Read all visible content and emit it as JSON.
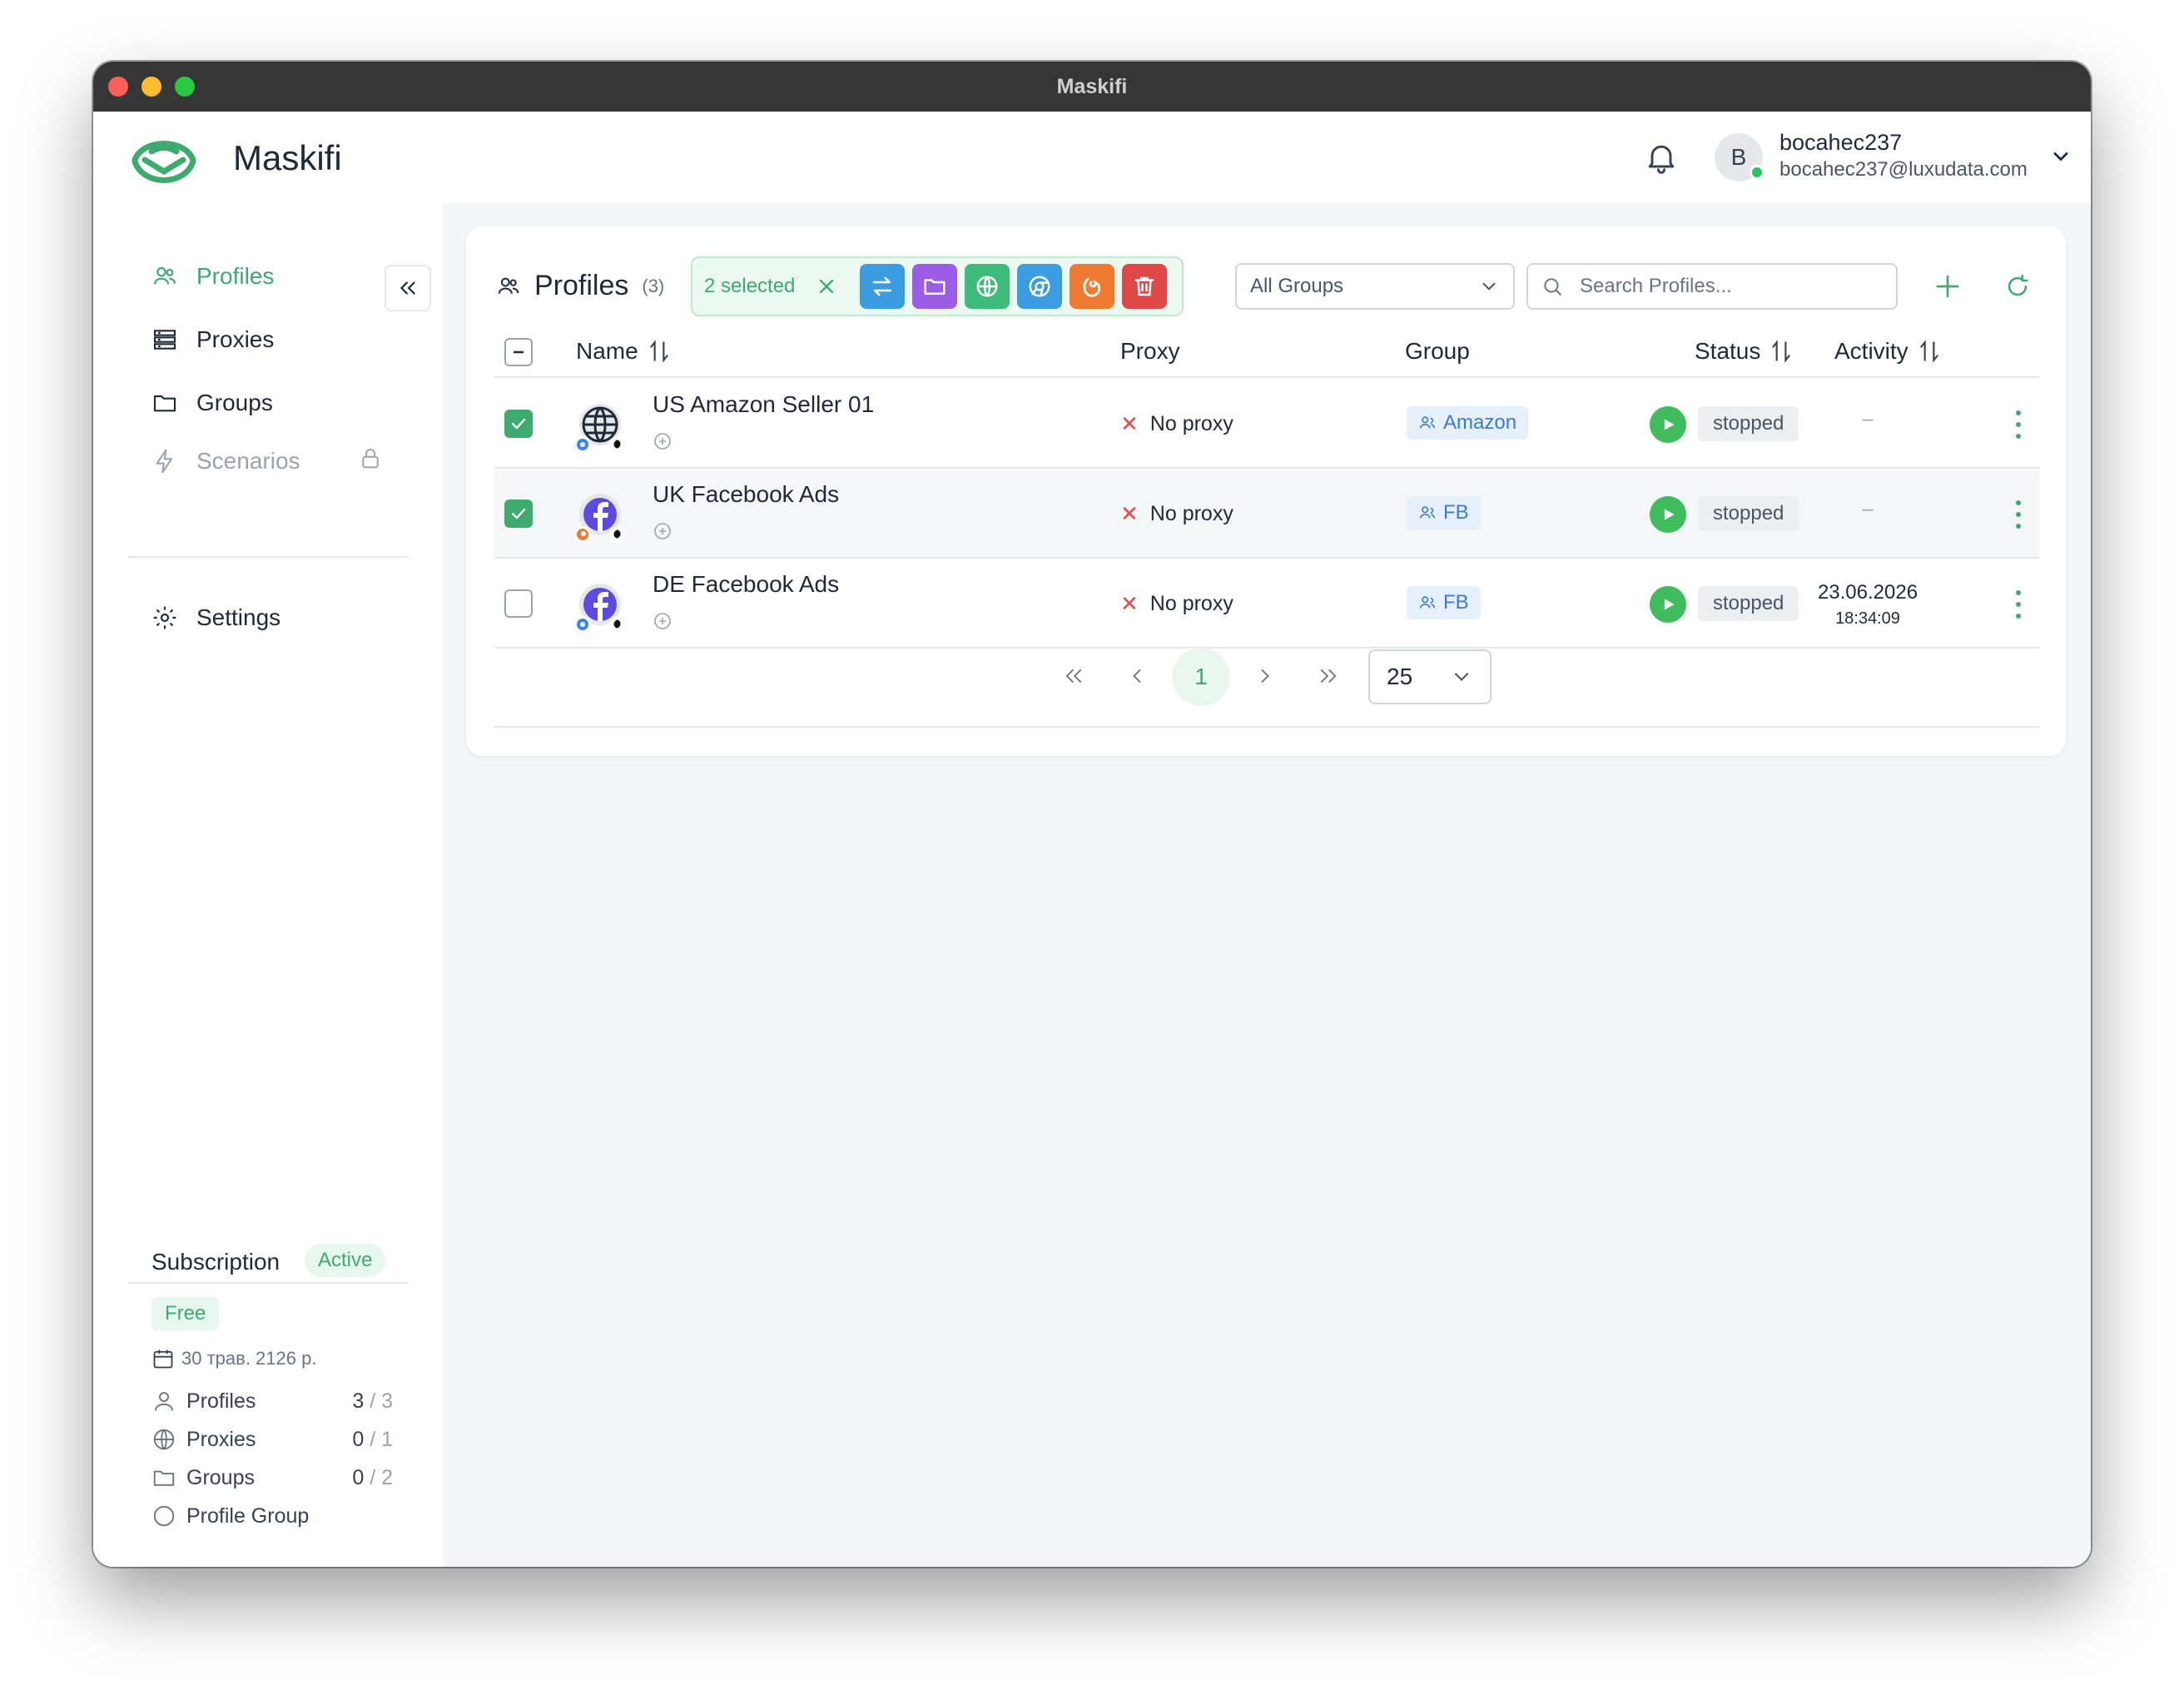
{
  "window": {
    "title": "Maskifi"
  },
  "app": {
    "brand": "Maskifi",
    "accent": "#3daa6e"
  },
  "user": {
    "initial": "B",
    "name": "bocahec237",
    "email": "bocahec237@luxudata.com"
  },
  "sidebar": {
    "items": [
      {
        "label": "Profiles",
        "icon": "users-icon",
        "active": true
      },
      {
        "label": "Proxies",
        "icon": "server-icon"
      },
      {
        "label": "Groups",
        "icon": "folder-icon"
      },
      {
        "label": "Scenarios",
        "icon": "bolt-icon",
        "locked": true
      },
      {
        "label": "Settings",
        "icon": "gear-icon"
      }
    ]
  },
  "subscription": {
    "title": "Subscription",
    "state": "Active",
    "plan": "Free",
    "date": "30 трав. 2126 р.",
    "limits": [
      {
        "label": "Profiles",
        "used": "3",
        "max": "/ 3"
      },
      {
        "label": "Proxies",
        "used": "0",
        "max": "/ 1"
      },
      {
        "label": "Groups",
        "used": "0",
        "max": "/ 2"
      },
      {
        "label": "Profile Group",
        "used": "",
        "max": ""
      }
    ]
  },
  "profiles": {
    "title": "Profiles",
    "count": "(3)",
    "selected_label": "2 selected",
    "group_filter": "All Groups",
    "search_placeholder": "Search Profiles...",
    "columns": {
      "name": "Name",
      "proxy": "Proxy",
      "group": "Group",
      "status": "Status",
      "activity": "Activity"
    },
    "rows": [
      {
        "name": "US Amazon Seller 01",
        "proxy": "No proxy",
        "group": "Amazon",
        "status": "stopped",
        "activity_date": "–",
        "activity_time": "",
        "checked": true,
        "icon": "globe-icon",
        "browser": "chrome-icon"
      },
      {
        "name": "UK Facebook Ads",
        "proxy": "No proxy",
        "group": "FB",
        "status": "stopped",
        "activity_date": "–",
        "activity_time": "",
        "checked": true,
        "icon": "facebook-icon",
        "browser": "firefox-icon"
      },
      {
        "name": "DE Facebook Ads",
        "proxy": "No proxy",
        "group": "FB",
        "status": "stopped",
        "activity_date": "23.06.2026",
        "activity_time": "18:34:09",
        "checked": false,
        "icon": "facebook-icon",
        "browser": "chrome-icon"
      }
    ],
    "pager": {
      "current_page": "1",
      "per_page": "25"
    }
  },
  "action_colors": {
    "move": "#3b9de0",
    "folder": "#9b5de5",
    "proxy": "#3dbb7a",
    "chrome": "#3b9de0",
    "firefox": "#ef7a32",
    "delete": "#e04848"
  }
}
